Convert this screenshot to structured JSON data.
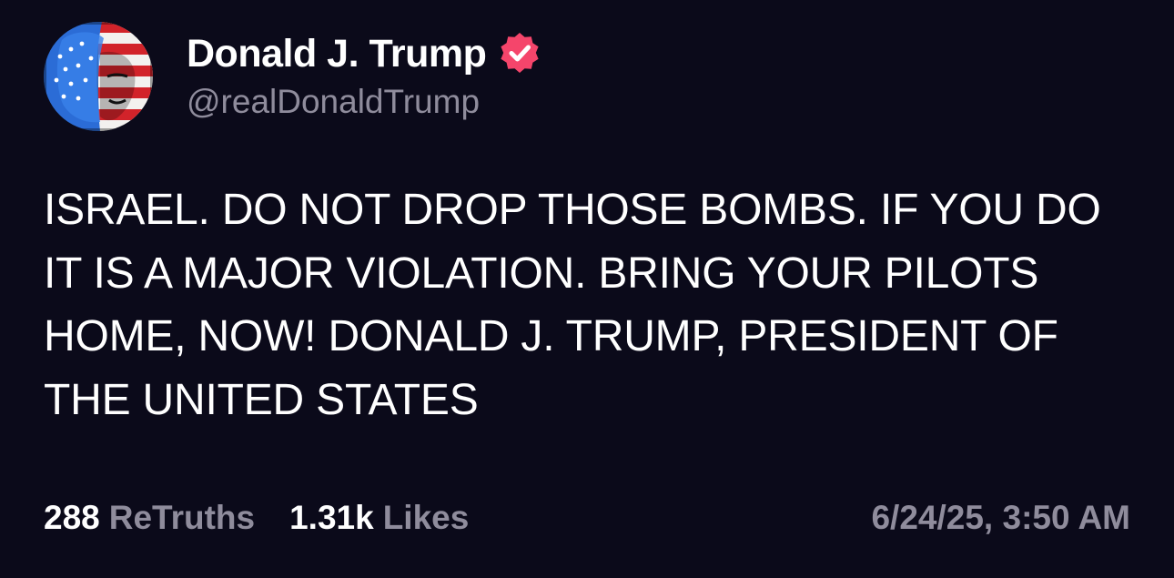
{
  "author": {
    "display_name": "Donald J. Trump",
    "handle": "@realDonaldTrump",
    "verified": true,
    "verified_color": "#f5456b"
  },
  "post": {
    "text": "ISRAEL. DO NOT DROP THOSE BOMBS. IF YOU DO IT IS A MAJOR VIOLATION. BRING YOUR PILOTS HOME, NOW! DONALD J. TRUMP, PRESIDENT OF THE UNITED STATES"
  },
  "stats": {
    "retruths_count": "288",
    "retruths_label": "ReTruths",
    "likes_count": "1.31k",
    "likes_label": "Likes",
    "timestamp": "6/24/25, 3:50 AM"
  },
  "colors": {
    "background": "#0b0a1a",
    "primary_text": "#ffffff",
    "secondary_text": "#8f8c9c"
  },
  "icons": {
    "avatar": "flag-portrait-avatar",
    "verified": "verified-badge-icon"
  }
}
